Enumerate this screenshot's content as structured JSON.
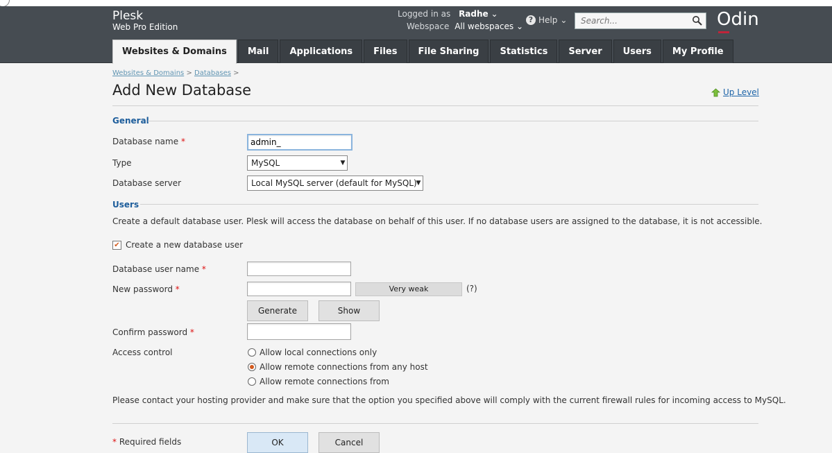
{
  "header": {
    "brand_name": "Plesk",
    "brand_edition": "Web Pro Edition",
    "logged_in_label": "Logged in as",
    "logged_in_user": "Radhe",
    "webspace_label": "Webspace",
    "webspace_value": "All webspaces",
    "help_label": "Help",
    "search_placeholder": "Search...",
    "logo_text": "Odin"
  },
  "tabs": [
    {
      "label": "Websites & Domains",
      "active": true
    },
    {
      "label": "Mail"
    },
    {
      "label": "Applications"
    },
    {
      "label": "Files"
    },
    {
      "label": "File Sharing"
    },
    {
      "label": "Statistics"
    },
    {
      "label": "Server"
    },
    {
      "label": "Users"
    },
    {
      "label": "My Profile"
    }
  ],
  "breadcrumb": [
    "Websites & Domains",
    "Databases"
  ],
  "page_title": "Add New Database",
  "up_level": "Up Level",
  "general": {
    "section_title": "General",
    "db_name_label": "Database name",
    "db_name_value": "admin_",
    "type_label": "Type",
    "type_value": "MySQL",
    "server_label": "Database server",
    "server_value": "Local MySQL server (default for MySQL)"
  },
  "users": {
    "section_title": "Users",
    "description": "Create a default database user. Plesk will access the database on behalf of this user. If no database users are assigned to the database, it is not accessible.",
    "create_user_label": "Create a new database user",
    "create_user_checked": true,
    "user_name_label": "Database user name",
    "new_password_label": "New password",
    "strength_text": "Very weak",
    "strength_help": "(?)",
    "generate_label": "Generate",
    "show_label": "Show",
    "confirm_password_label": "Confirm password",
    "access_label": "Access control",
    "access_options": [
      "Allow local connections only",
      "Allow remote connections from any host",
      "Allow remote connections from"
    ],
    "access_selected": 1
  },
  "note": "Please contact your hosting provider and make sure that the option you specified above will comply with the current firewall rules for incoming access to MySQL.",
  "footer": {
    "required_note": "Required fields",
    "ok_label": "OK",
    "cancel_label": "Cancel"
  },
  "colors": {
    "header_bg": "#464c52",
    "link": "#1d64a8",
    "section": "#1d5d9b",
    "accent": "#d25a1e"
  }
}
